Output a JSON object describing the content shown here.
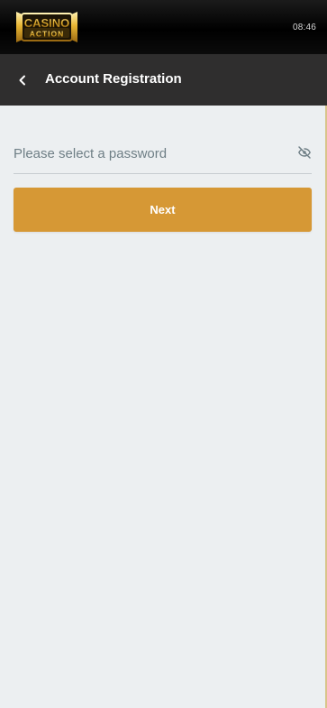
{
  "status": {
    "time": "08:46"
  },
  "brand": {
    "logo_text_top": "CASINO",
    "logo_text_bottom": "ACTION"
  },
  "header": {
    "title": "Account Registration"
  },
  "form": {
    "password_placeholder": "Please select a password",
    "password_value": ""
  },
  "actions": {
    "next_label": "Next"
  },
  "colors": {
    "accent": "#d69835",
    "header_bg": "#2f2e2e",
    "topbar_bg": "#000000",
    "page_bg": "#eceff1"
  },
  "icons": {
    "back": "chevron-left-icon",
    "visibility": "eye-off-icon"
  }
}
